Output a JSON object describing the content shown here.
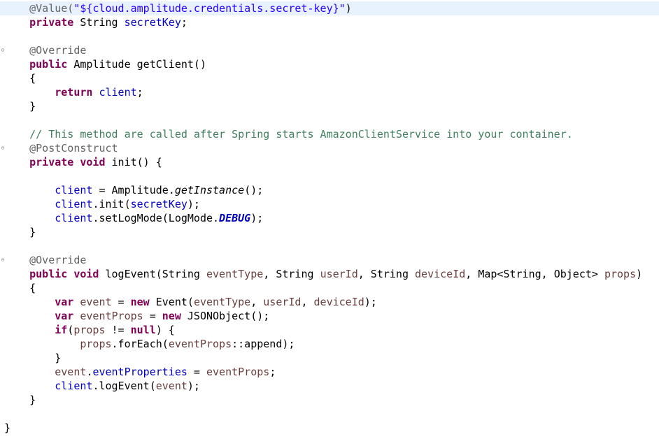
{
  "editor": {
    "lines": [
      {
        "fold": false,
        "current": true,
        "tokens": [
          {
            "t": "    ",
            "c": ""
          },
          {
            "t": "@Value(",
            "c": "ann"
          },
          {
            "t": "\"${cloud.amplitude.credentials.secret-key}\"",
            "c": "str"
          },
          {
            "t": ")",
            "c": ""
          }
        ]
      },
      {
        "fold": false,
        "tokens": [
          {
            "t": "    ",
            "c": ""
          },
          {
            "t": "private",
            "c": "kw"
          },
          {
            "t": " String ",
            "c": ""
          },
          {
            "t": "secretKey",
            "c": "fld"
          },
          {
            "t": ";",
            "c": ""
          }
        ]
      },
      {
        "fold": false,
        "tokens": []
      },
      {
        "fold": true,
        "tokens": [
          {
            "t": "    ",
            "c": ""
          },
          {
            "t": "@Override",
            "c": "ann"
          }
        ]
      },
      {
        "fold": false,
        "tokens": [
          {
            "t": "    ",
            "c": ""
          },
          {
            "t": "public",
            "c": "kw"
          },
          {
            "t": " Amplitude getClient()",
            "c": ""
          }
        ]
      },
      {
        "fold": false,
        "tokens": [
          {
            "t": "    {",
            "c": ""
          }
        ]
      },
      {
        "fold": false,
        "tokens": [
          {
            "t": "        ",
            "c": ""
          },
          {
            "t": "return",
            "c": "kw"
          },
          {
            "t": " ",
            "c": ""
          },
          {
            "t": "client",
            "c": "fld"
          },
          {
            "t": ";",
            "c": ""
          }
        ]
      },
      {
        "fold": false,
        "tokens": [
          {
            "t": "    }",
            "c": ""
          }
        ]
      },
      {
        "fold": false,
        "tokens": []
      },
      {
        "fold": false,
        "tokens": [
          {
            "t": "    ",
            "c": ""
          },
          {
            "t": "// This method are called after Spring starts AmazonClientService into your container.",
            "c": "cmt"
          }
        ]
      },
      {
        "fold": true,
        "tokens": [
          {
            "t": "    ",
            "c": ""
          },
          {
            "t": "@PostConstruct",
            "c": "ann"
          }
        ]
      },
      {
        "fold": false,
        "tokens": [
          {
            "t": "    ",
            "c": ""
          },
          {
            "t": "private",
            "c": "kw"
          },
          {
            "t": " ",
            "c": ""
          },
          {
            "t": "void",
            "c": "kw"
          },
          {
            "t": " init() {",
            "c": ""
          }
        ]
      },
      {
        "fold": false,
        "tokens": []
      },
      {
        "fold": false,
        "tokens": [
          {
            "t": "        ",
            "c": ""
          },
          {
            "t": "client",
            "c": "fld"
          },
          {
            "t": " = Amplitude.",
            "c": ""
          },
          {
            "t": "getInstance",
            "c": "smi"
          },
          {
            "t": "();",
            "c": ""
          }
        ]
      },
      {
        "fold": false,
        "tokens": [
          {
            "t": "        ",
            "c": ""
          },
          {
            "t": "client",
            "c": "fld"
          },
          {
            "t": ".init(",
            "c": ""
          },
          {
            "t": "secretKey",
            "c": "fld"
          },
          {
            "t": ");",
            "c": ""
          }
        ]
      },
      {
        "fold": false,
        "tokens": [
          {
            "t": "        ",
            "c": ""
          },
          {
            "t": "client",
            "c": "fld"
          },
          {
            "t": ".setLogMode(LogMode.",
            "c": ""
          },
          {
            "t": "DEBUG",
            "c": "sfld"
          },
          {
            "t": ");",
            "c": ""
          }
        ]
      },
      {
        "fold": false,
        "tokens": [
          {
            "t": "    }",
            "c": ""
          }
        ]
      },
      {
        "fold": false,
        "tokens": []
      },
      {
        "fold": true,
        "tokens": [
          {
            "t": "    ",
            "c": ""
          },
          {
            "t": "@Override",
            "c": "ann"
          }
        ]
      },
      {
        "fold": false,
        "tokens": [
          {
            "t": "    ",
            "c": ""
          },
          {
            "t": "public",
            "c": "kw"
          },
          {
            "t": " ",
            "c": ""
          },
          {
            "t": "void",
            "c": "kw"
          },
          {
            "t": " logEvent(String ",
            "c": ""
          },
          {
            "t": "eventType",
            "c": "var"
          },
          {
            "t": ", String ",
            "c": ""
          },
          {
            "t": "userId",
            "c": "var"
          },
          {
            "t": ", String ",
            "c": ""
          },
          {
            "t": "deviceId",
            "c": "var"
          },
          {
            "t": ", Map<String, Object> ",
            "c": ""
          },
          {
            "t": "props",
            "c": "var"
          },
          {
            "t": ")",
            "c": ""
          }
        ]
      },
      {
        "fold": false,
        "tokens": [
          {
            "t": "    {",
            "c": ""
          }
        ]
      },
      {
        "fold": false,
        "tokens": [
          {
            "t": "        ",
            "c": ""
          },
          {
            "t": "var",
            "c": "kw"
          },
          {
            "t": " ",
            "c": ""
          },
          {
            "t": "event",
            "c": "var"
          },
          {
            "t": " = ",
            "c": ""
          },
          {
            "t": "new",
            "c": "kw"
          },
          {
            "t": " Event(",
            "c": ""
          },
          {
            "t": "eventType",
            "c": "var"
          },
          {
            "t": ", ",
            "c": ""
          },
          {
            "t": "userId",
            "c": "var"
          },
          {
            "t": ", ",
            "c": ""
          },
          {
            "t": "deviceId",
            "c": "var"
          },
          {
            "t": ");",
            "c": ""
          }
        ]
      },
      {
        "fold": false,
        "tokens": [
          {
            "t": "        ",
            "c": ""
          },
          {
            "t": "var",
            "c": "kw"
          },
          {
            "t": " ",
            "c": ""
          },
          {
            "t": "eventProps",
            "c": "var"
          },
          {
            "t": " = ",
            "c": ""
          },
          {
            "t": "new",
            "c": "kw"
          },
          {
            "t": " JSONObject();",
            "c": ""
          }
        ]
      },
      {
        "fold": false,
        "tokens": [
          {
            "t": "        ",
            "c": ""
          },
          {
            "t": "if",
            "c": "kw"
          },
          {
            "t": "(",
            "c": ""
          },
          {
            "t": "props",
            "c": "var"
          },
          {
            "t": " != ",
            "c": ""
          },
          {
            "t": "null",
            "c": "kw"
          },
          {
            "t": ") {",
            "c": ""
          }
        ]
      },
      {
        "fold": false,
        "tokens": [
          {
            "t": "            ",
            "c": ""
          },
          {
            "t": "props",
            "c": "var"
          },
          {
            "t": ".forEach(",
            "c": ""
          },
          {
            "t": "eventProps",
            "c": "var"
          },
          {
            "t": "::append);",
            "c": ""
          }
        ]
      },
      {
        "fold": false,
        "tokens": [
          {
            "t": "        }",
            "c": ""
          }
        ]
      },
      {
        "fold": false,
        "tokens": [
          {
            "t": "        ",
            "c": ""
          },
          {
            "t": "event",
            "c": "var"
          },
          {
            "t": ".",
            "c": ""
          },
          {
            "t": "eventProperties",
            "c": "fld"
          },
          {
            "t": " = ",
            "c": ""
          },
          {
            "t": "eventProps",
            "c": "var"
          },
          {
            "t": ";",
            "c": ""
          }
        ]
      },
      {
        "fold": false,
        "tokens": [
          {
            "t": "        ",
            "c": ""
          },
          {
            "t": "client",
            "c": "fld"
          },
          {
            "t": ".logEvent(",
            "c": ""
          },
          {
            "t": "event",
            "c": "var"
          },
          {
            "t": ");",
            "c": ""
          }
        ]
      },
      {
        "fold": false,
        "tokens": [
          {
            "t": "    }",
            "c": ""
          }
        ]
      },
      {
        "fold": false,
        "tokens": []
      },
      {
        "fold": false,
        "tokens": [
          {
            "t": "}",
            "c": ""
          }
        ]
      }
    ]
  },
  "colors": {
    "keyword": "#7f0055",
    "annotation": "#646464",
    "string": "#2a00ff",
    "field": "#0000c0",
    "local_variable": "#6a3e3e",
    "comment": "#3f7f5f",
    "current_line": "#e8f2fe"
  },
  "icons": {
    "fold_marker": "collapse-icon"
  }
}
